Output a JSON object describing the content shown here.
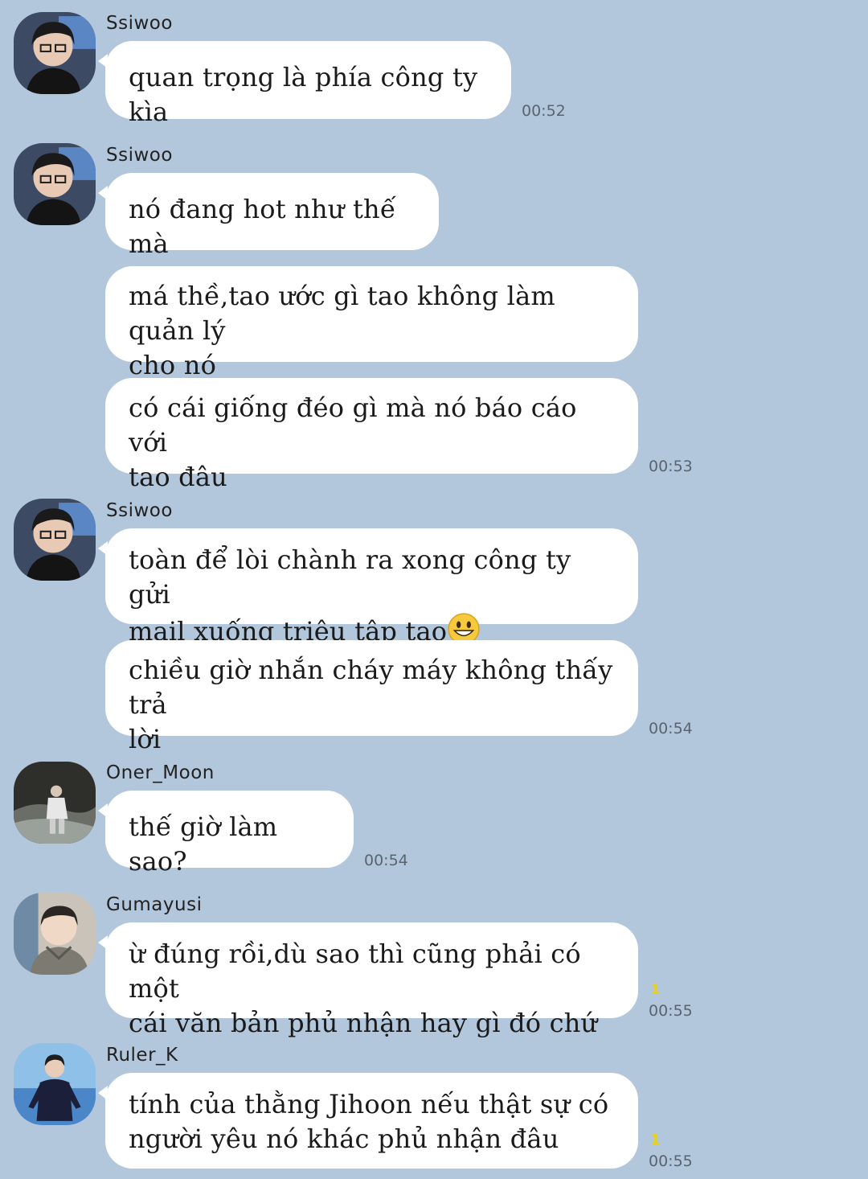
{
  "messages": [
    {
      "sender": "Ssiwoo",
      "lines": [
        "quan trọng là phía công ty kìa"
      ],
      "time": "00:52"
    },
    {
      "sender": "Ssiwoo",
      "lines": [
        "nó đang hot như thế mà"
      ]
    },
    {
      "lines": [
        "má thề,tao ước gì tao không làm quản lý",
        "cho nó"
      ]
    },
    {
      "lines": [
        "có cái giống đéo gì mà nó báo cáo với",
        "tao đâu"
      ],
      "time": "00:53"
    },
    {
      "sender": "Ssiwoo",
      "lines": [
        "toàn để lòi chành ra xong công ty gửi",
        "mail xuống triệu tập tao"
      ]
    },
    {
      "lines": [
        "chiều giờ nhắn cháy máy không thấy trả",
        "lời"
      ],
      "time": "00:54"
    },
    {
      "sender": "Oner_Moon",
      "lines": [
        "thế giờ làm sao?"
      ],
      "time": "00:54"
    },
    {
      "sender": "Gumayusi",
      "lines": [
        "ừ đúng rồi,dù sao thì cũng phải có một",
        "cái văn bản phủ nhận hay gì đó chứ"
      ],
      "unread": "1",
      "time": "00:55"
    },
    {
      "sender": "Ruler_K",
      "lines": [
        "tính của thằng Jihoon nếu thật sự có",
        "người yêu nó khác phủ nhận đâu"
      ],
      "unread": "1",
      "time": "00:55"
    }
  ],
  "icons": {
    "ssiwoo_avatar": "avatar-photo-ssiwoo",
    "oner_avatar": "avatar-photo-oner-moon",
    "gumayusi_avatar": "avatar-photo-gumayusi",
    "ruler_avatar": "avatar-photo-ruler-k",
    "emoji": "grinning-face-emoji"
  },
  "colors": {
    "background": "#b3c7dc",
    "bubble": "#ffffff",
    "unread": "#e6d21c"
  }
}
